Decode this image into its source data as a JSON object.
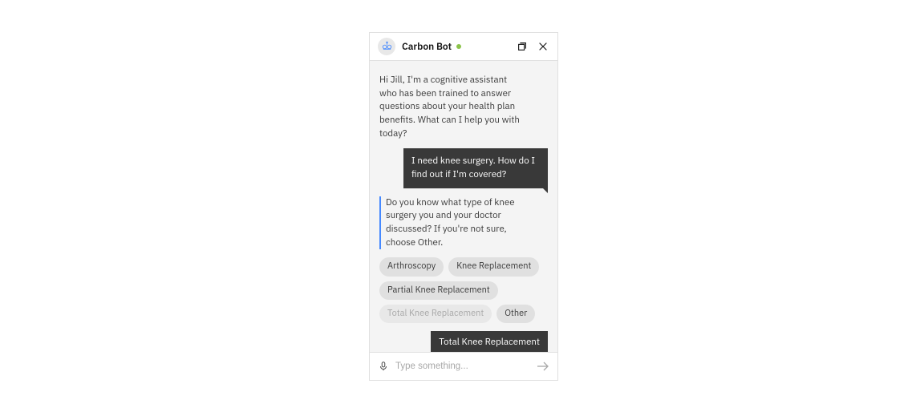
{
  "header": {
    "bot_name": "Carbon Bot",
    "status": "online"
  },
  "messages": {
    "bot_intro": "Hi Jill, I'm a cognitive assistant who has been trained to answer questions about your health plan benefits. What can I help you with today?",
    "user_q1": "I need knee surgery. How do I find out if I'm covered?",
    "bot_q1": "Do you know what type of knee surgery you and your doctor discussed? If you're not sure, choose Other.",
    "user_selection": "Total Knee Replacement"
  },
  "chips": [
    {
      "label": "Arthroscopy",
      "disabled": false
    },
    {
      "label": "Knee Replacement",
      "disabled": false
    },
    {
      "label": "Partial Knee Replacement",
      "disabled": false
    },
    {
      "label": "Total Knee Replacement",
      "disabled": true
    },
    {
      "label": "Other",
      "disabled": false
    }
  ],
  "input": {
    "placeholder": "Type something..."
  },
  "colors": {
    "accent": "#4589ff",
    "user_msg_bg": "#393939",
    "chip_bg": "#e0e0e0",
    "status_dot": "#8bc34a"
  }
}
